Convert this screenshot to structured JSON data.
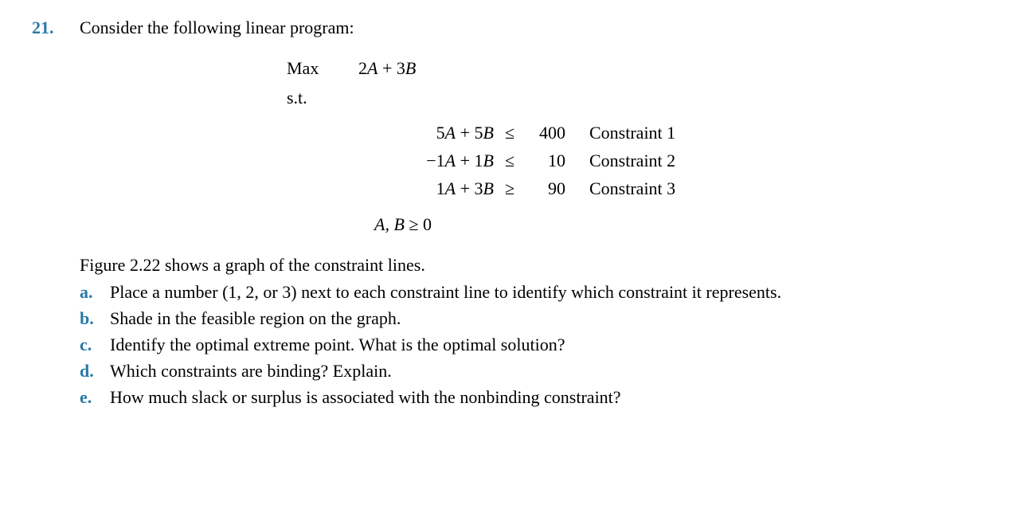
{
  "question": {
    "number": "21.",
    "prompt": "Consider the following linear program:"
  },
  "lp": {
    "max_label": "Max",
    "objective_coef1": "2",
    "objective_var1": "A",
    "objective_plus": " + ",
    "objective_coef2": "3",
    "objective_var2": "B",
    "st_label": "s.t."
  },
  "constraints": [
    {
      "lhs_c1": "5",
      "lhs_v1": "A",
      "lhs_mid": " + ",
      "lhs_c2": "5",
      "lhs_v2": "B",
      "op": "≤",
      "rhs": "400",
      "label": "Constraint 1"
    },
    {
      "lhs_c1": "−1",
      "lhs_v1": "A",
      "lhs_mid": " + ",
      "lhs_c2": "1",
      "lhs_v2": "B",
      "op": "≤",
      "rhs": "10",
      "label": "Constraint 2"
    },
    {
      "lhs_c1": "1",
      "lhs_v1": "A",
      "lhs_mid": " + ",
      "lhs_c2": "3",
      "lhs_v2": "B",
      "op": "≥",
      "rhs": "90",
      "label": "Constraint 3"
    }
  ],
  "nonneg": {
    "vars": "A, B",
    "op": " ≥ ",
    "rhs": "0"
  },
  "figure_line": "Figure 2.22 shows a graph of the constraint lines.",
  "subparts": [
    {
      "letter": "a.",
      "text": "Place a number (1, 2, or 3) next to each constraint line to identify which constraint it represents."
    },
    {
      "letter": "b.",
      "text": "Shade in the feasible region on the graph."
    },
    {
      "letter": "c.",
      "text": "Identify the optimal extreme point. What is the optimal solution?"
    },
    {
      "letter": "d.",
      "text": "Which constraints are binding? Explain."
    },
    {
      "letter": "e.",
      "text": "How much slack or surplus is associated with the nonbinding constraint?"
    }
  ]
}
